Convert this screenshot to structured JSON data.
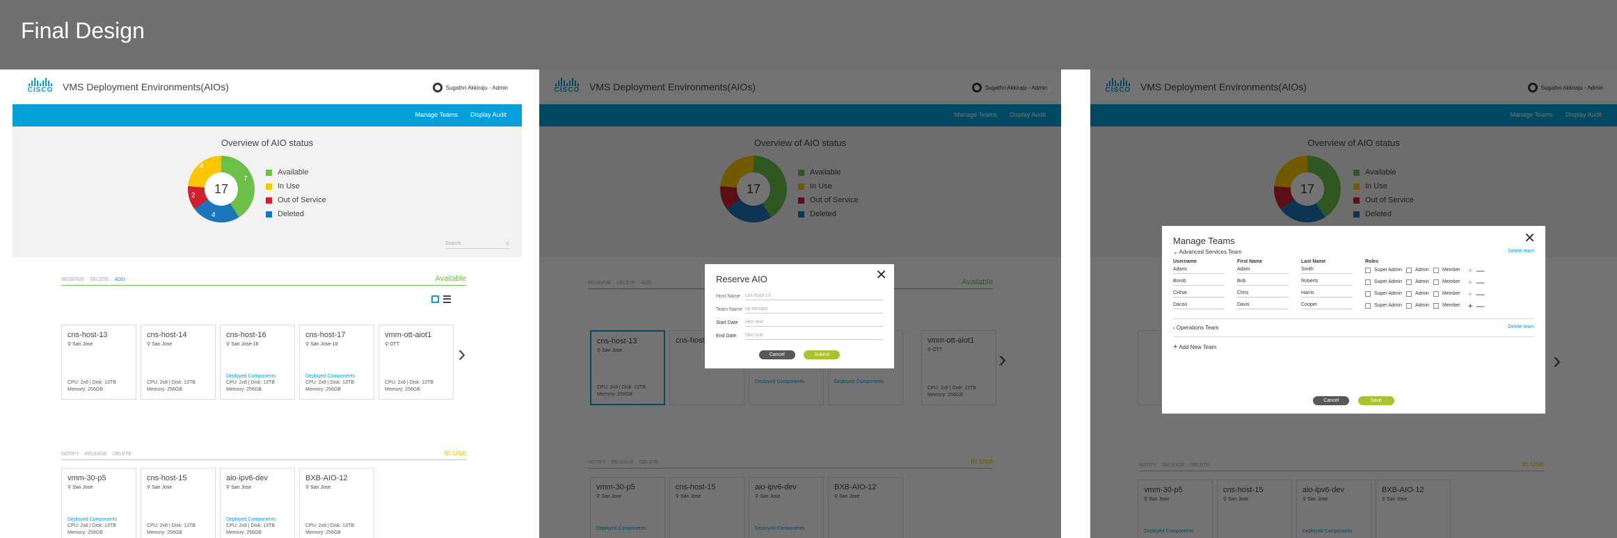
{
  "page_title": "Final Design",
  "app": {
    "title": "VMS Deployment Environments(AIOs)",
    "logo_text": "CISCO",
    "user": "Sugathri Akkiraju - Admin",
    "nav": [
      "Manage Teams",
      "Display Audit"
    ]
  },
  "overview": {
    "title": "Overview of AIO status",
    "total": "17",
    "slices": {
      "available": "7",
      "in_use": "4",
      "out_of_service": "2",
      "deleted": "4"
    },
    "legend": [
      "Available",
      "In Use",
      "Out of Service",
      "Deleted"
    ],
    "colors": {
      "available": "#6cc04a",
      "in_use": "#fbc500",
      "out_of_service": "#cf2030",
      "deleted": "#1b75bb",
      "accent": "#049fd9"
    },
    "search_placeholder": "Search"
  },
  "available": {
    "tabs": [
      "RESERVE",
      "DELETE",
      "ADD"
    ],
    "status": "Available",
    "cards": [
      {
        "name": "cns-host-13",
        "loc": "San Jose",
        "deployed": "",
        "specs": "CPU: 2x8 | Disk: 13TB",
        "mem": "Memory: 256GB"
      },
      {
        "name": "cns-host-14",
        "loc": "San Jose",
        "deployed": "",
        "specs": "CPU: 2x8 | Disk: 13TB",
        "mem": "Memory: 256GB"
      },
      {
        "name": "cns-host-16",
        "loc": "San Jose-16",
        "deployed": "Deployed Components",
        "specs": "CPU: 2x8 | Disk: 13TB",
        "mem": "Memory: 256GB"
      },
      {
        "name": "cns-host-17",
        "loc": "San Jose-18",
        "deployed": "Deployed Components",
        "specs": "CPU: 2x8 | Disk: 13TB",
        "mem": "Memory: 256GB"
      },
      {
        "name": "vmm-ott-aiot1",
        "loc": "OTT",
        "deployed": "",
        "specs": "CPU: 2x8 | Disk: 13TB",
        "mem": "Memory: 256GB"
      }
    ]
  },
  "in_use": {
    "tabs": [
      "NOTIFY",
      "RELEASE",
      "DELETE"
    ],
    "status": "In Use",
    "cards": [
      {
        "name": "vmm-30-p5",
        "loc": "San Jose",
        "deployed": "Deployed Components",
        "specs": "CPU: 2x8 | Disk: 13TB",
        "mem": "Memory: 256GB"
      },
      {
        "name": "cns-host-15",
        "loc": "San Jose",
        "deployed": "",
        "specs": "CPU: 2x8 | Disk: 13TB",
        "mem": "Memory: 256GB"
      },
      {
        "name": "aio-ipv6-dev",
        "loc": "San Jose",
        "deployed": "Deployed Components",
        "specs": "CPU: 2x8 | Disk: 13TB",
        "mem": "Memory: 256GB"
      },
      {
        "name": "BXB-AIO-12",
        "loc": "San Jose",
        "deployed": "",
        "specs": "CPU: 2x8 | Disk: 13TB",
        "mem": "Memory: 256GB"
      }
    ]
  },
  "reserve": {
    "title": "Reserve AIO",
    "fields": [
      {
        "label": "Host Name",
        "value": "cns-host-13"
      },
      {
        "label": "Team Name",
        "value": "vp-devops"
      },
      {
        "label": "Start Date",
        "value": "Hint text"
      },
      {
        "label": "End Date",
        "value": "Hint text"
      }
    ],
    "cancel": "Cancel",
    "submit": "Submit"
  },
  "manage": {
    "title": "Manage Teams",
    "team1": "Advanced Services Team",
    "team2": "Operations Team",
    "add": "Add New Team",
    "delete": "Delete team",
    "headers": [
      "Username",
      "First Name",
      "Last Name",
      "Roles"
    ],
    "roles": [
      "Super Admin",
      "Admin",
      "Member"
    ],
    "rows": [
      [
        "Adami",
        "Adam",
        "Smith"
      ],
      [
        "Borob",
        "Bob",
        "Roberts"
      ],
      [
        "CHhar",
        "Chris",
        "Harris"
      ],
      [
        "Dacoo",
        "Davis",
        "Cooper"
      ]
    ],
    "cancel": "Cancel",
    "save": "Save"
  }
}
